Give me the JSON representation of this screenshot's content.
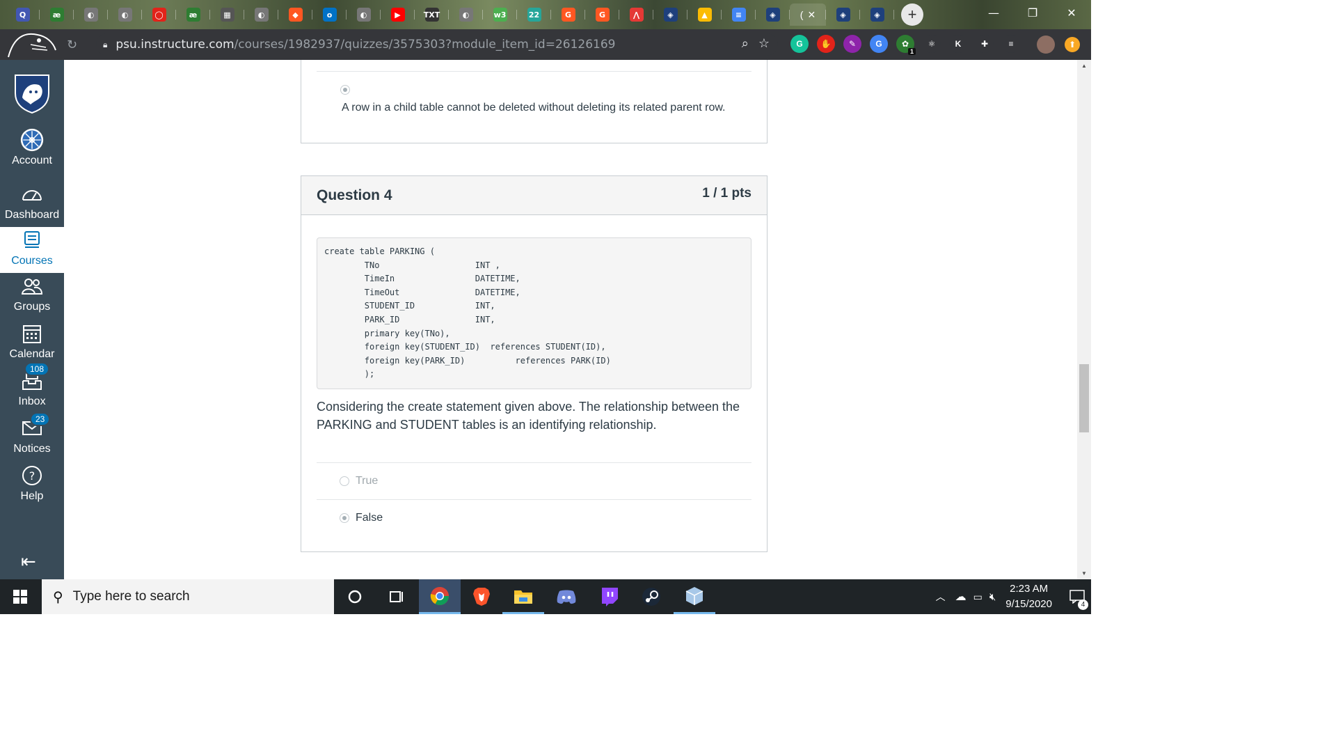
{
  "browser": {
    "url_host": "psu.instructure.com",
    "url_path": "/courses/1982937/quizzes/3575303?module_item_id=26126169",
    "tabs": [
      {
        "icon": "quizlet-icon",
        "glyph": "Q",
        "color": "#4257b2"
      },
      {
        "icon": "ae-icon",
        "glyph": "æ",
        "color": "#2e7d32"
      },
      {
        "icon": "globe-icon",
        "glyph": "◐",
        "color": "#777"
      },
      {
        "icon": "globe-icon",
        "glyph": "◐",
        "color": "#777"
      },
      {
        "icon": "oracle-icon",
        "glyph": "◯",
        "color": "#e2231a"
      },
      {
        "icon": "ae-icon",
        "glyph": "æ",
        "color": "#2e7d32"
      },
      {
        "icon": "image-icon",
        "glyph": "▦",
        "color": "#555"
      },
      {
        "icon": "globe-icon",
        "glyph": "◐",
        "color": "#777"
      },
      {
        "icon": "shield-icon",
        "glyph": "◆",
        "color": "#ff5722"
      },
      {
        "icon": "outlook-icon",
        "glyph": "o",
        "color": "#0072c6"
      },
      {
        "icon": "globe-icon",
        "glyph": "◐",
        "color": "#777"
      },
      {
        "icon": "youtube-icon",
        "glyph": "▶",
        "color": "#ff0000"
      },
      {
        "icon": "txt-icon",
        "glyph": "TXT",
        "color": "#333"
      },
      {
        "icon": "globe-icon",
        "glyph": "◐",
        "color": "#777"
      },
      {
        "icon": "w3-icon",
        "glyph": "w3",
        "color": "#4caf50"
      },
      {
        "icon": "22-icon",
        "glyph": "22",
        "color": "#26a69a"
      },
      {
        "icon": "g-icon",
        "glyph": "G",
        "color": "#ff5722"
      },
      {
        "icon": "g-icon",
        "glyph": "G",
        "color": "#ff5722"
      },
      {
        "icon": "chart-icon",
        "glyph": "⋀",
        "color": "#e53935"
      },
      {
        "icon": "psu-icon",
        "glyph": "◈",
        "color": "#1e407c"
      },
      {
        "icon": "drive-icon",
        "glyph": "▲",
        "color": "#fbbc04"
      },
      {
        "icon": "docs-icon",
        "glyph": "≡",
        "color": "#4285f4"
      },
      {
        "icon": "psu-icon",
        "glyph": "◈",
        "color": "#1e407c"
      }
    ],
    "active_tab_glyph": "(",
    "tabs_after": [
      {
        "icon": "psu-icon",
        "glyph": "◈",
        "color": "#1e407c"
      },
      {
        "icon": "psu-icon",
        "glyph": "◈",
        "color": "#1e407c"
      }
    ],
    "extensions": [
      {
        "icon": "grammarly-icon",
        "glyph": "G",
        "color": "#15c39a",
        "badge": ""
      },
      {
        "icon": "adblock-icon",
        "glyph": "✋",
        "color": "#e2231a",
        "badge": ""
      },
      {
        "icon": "feather-icon",
        "glyph": "✎",
        "color": "#8e24aa",
        "badge": ""
      },
      {
        "icon": "translate-icon",
        "glyph": "G",
        "color": "#4285f4",
        "badge": ""
      },
      {
        "icon": "bug-icon",
        "glyph": "✿",
        "color": "#2e7d32",
        "badge": "1"
      },
      {
        "icon": "react-icon",
        "glyph": "⚛",
        "color": "#35363a",
        "badge": ""
      },
      {
        "icon": "k-icon",
        "glyph": "K",
        "color": "#35363a",
        "badge": ""
      },
      {
        "icon": "puzzle-icon",
        "glyph": "✚",
        "color": "#35363a",
        "badge": ""
      },
      {
        "icon": "playlist-icon",
        "glyph": "≡",
        "color": "#35363a",
        "badge": ""
      }
    ]
  },
  "sidebar": {
    "items": [
      {
        "label": "Account",
        "icon": "account-icon"
      },
      {
        "label": "Dashboard",
        "icon": "dashboard-icon"
      },
      {
        "label": "Courses",
        "icon": "courses-icon"
      },
      {
        "label": "Groups",
        "icon": "groups-icon"
      },
      {
        "label": "Calendar",
        "icon": "calendar-icon"
      },
      {
        "label": "Inbox",
        "icon": "inbox-icon",
        "badge": "108"
      },
      {
        "label": "Notices",
        "icon": "notices-icon",
        "badge": "23"
      },
      {
        "label": "Help",
        "icon": "help-icon"
      }
    ]
  },
  "prev_question": {
    "answer_text": "A row in a child table cannot be deleted without deleting its related parent row."
  },
  "question": {
    "title": "Question 4",
    "points": "1 / 1 pts",
    "code_lines": [
      "create table PARKING (",
      "        TNo                   INT ,",
      "        TimeIn                DATETIME,",
      "        TimeOut               DATETIME,",
      "        STUDENT_ID            INT,",
      "        PARK_ID               INT,",
      "        primary key(TNo),",
      "        foreign key(STUDENT_ID)  references STUDENT(ID),",
      "        foreign key(PARK_ID)          references PARK(ID)",
      "        );"
    ],
    "text": "Considering the create statement given above. The relationship between the PARKING and STUDENT tables is an identifying relationship.",
    "answers": [
      {
        "label": "True",
        "selected": false
      },
      {
        "label": "False",
        "selected": true
      }
    ]
  },
  "taskbar": {
    "search_placeholder": "Type here to search",
    "time": "2:23 AM",
    "date": "9/15/2020",
    "notification_count": "4"
  }
}
